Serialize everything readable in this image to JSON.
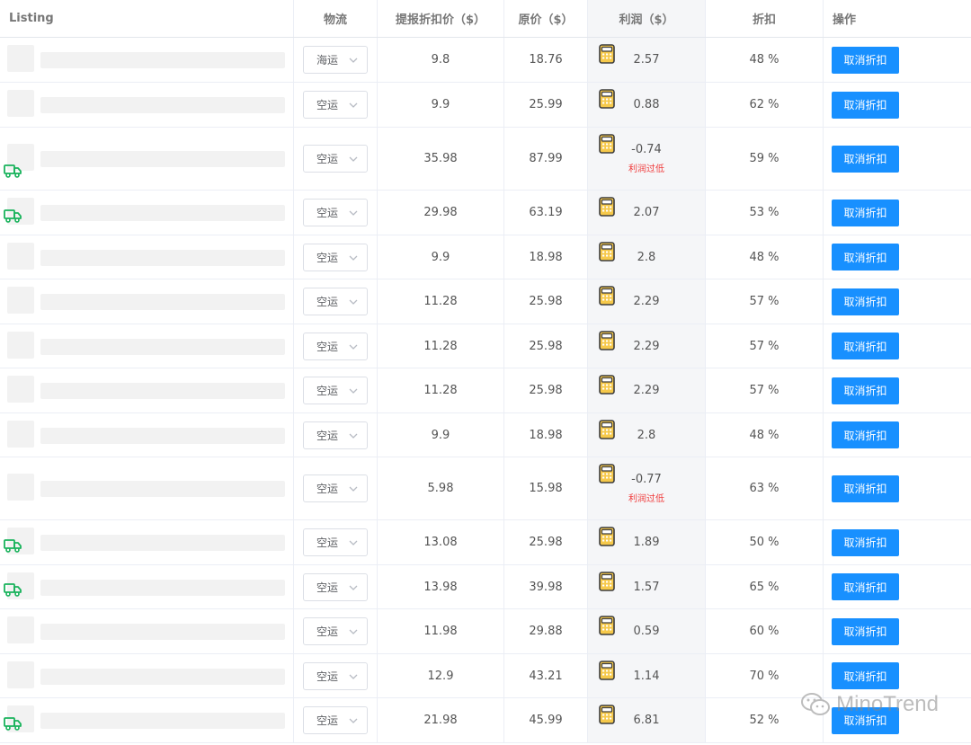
{
  "header": {
    "listing": "Listing",
    "shipping": "物流",
    "discount_price": "提报折扣价（$）",
    "original_price": "原价（$）",
    "profit": "利润（$）",
    "discount": "折扣",
    "action": "操作"
  },
  "rows": [
    {
      "ship": "海运",
      "disc": "9.8",
      "orig": "18.76",
      "profit": "2.57",
      "warn": "",
      "rate": "48 %",
      "action": "取消折扣",
      "truck": false
    },
    {
      "ship": "空运",
      "disc": "9.9",
      "orig": "25.99",
      "profit": "0.88",
      "warn": "",
      "rate": "62 %",
      "action": "取消折扣",
      "truck": false
    },
    {
      "ship": "空运",
      "disc": "35.98",
      "orig": "87.99",
      "profit": "-0.74",
      "warn": "利润过低",
      "rate": "59 %",
      "action": "取消折扣",
      "truck": true
    },
    {
      "ship": "空运",
      "disc": "29.98",
      "orig": "63.19",
      "profit": "2.07",
      "warn": "",
      "rate": "53 %",
      "action": "取消折扣",
      "truck": true
    },
    {
      "ship": "空运",
      "disc": "9.9",
      "orig": "18.98",
      "profit": "2.8",
      "warn": "",
      "rate": "48 %",
      "action": "取消折扣",
      "truck": false
    },
    {
      "ship": "空运",
      "disc": "11.28",
      "orig": "25.98",
      "profit": "2.29",
      "warn": "",
      "rate": "57 %",
      "action": "取消折扣",
      "truck": false
    },
    {
      "ship": "空运",
      "disc": "11.28",
      "orig": "25.98",
      "profit": "2.29",
      "warn": "",
      "rate": "57 %",
      "action": "取消折扣",
      "truck": false
    },
    {
      "ship": "空运",
      "disc": "11.28",
      "orig": "25.98",
      "profit": "2.29",
      "warn": "",
      "rate": "57 %",
      "action": "取消折扣",
      "truck": false
    },
    {
      "ship": "空运",
      "disc": "9.9",
      "orig": "18.98",
      "profit": "2.8",
      "warn": "",
      "rate": "48 %",
      "action": "取消折扣",
      "truck": false
    },
    {
      "ship": "空运",
      "disc": "5.98",
      "orig": "15.98",
      "profit": "-0.77",
      "warn": "利润过低",
      "rate": "63 %",
      "action": "取消折扣",
      "truck": false
    },
    {
      "ship": "空运",
      "disc": "13.08",
      "orig": "25.98",
      "profit": "1.89",
      "warn": "",
      "rate": "50 %",
      "action": "取消折扣",
      "truck": true
    },
    {
      "ship": "空运",
      "disc": "13.98",
      "orig": "39.98",
      "profit": "1.57",
      "warn": "",
      "rate": "65 %",
      "action": "取消折扣",
      "truck": true
    },
    {
      "ship": "空运",
      "disc": "11.98",
      "orig": "29.88",
      "profit": "0.59",
      "warn": "",
      "rate": "60 %",
      "action": "取消折扣",
      "truck": false
    },
    {
      "ship": "空运",
      "disc": "12.9",
      "orig": "43.21",
      "profit": "1.14",
      "warn": "",
      "rate": "70 %",
      "action": "取消折扣",
      "truck": false
    },
    {
      "ship": "空运",
      "disc": "21.98",
      "orig": "45.99",
      "profit": "6.81",
      "warn": "",
      "rate": "52 %",
      "action": "取消折扣",
      "truck": true
    }
  ],
  "watermark": "MinoTrend",
  "colors": {
    "primary_button": "#1890ff",
    "warning": "#f03b3b",
    "truck_icon": "#19b35c"
  }
}
